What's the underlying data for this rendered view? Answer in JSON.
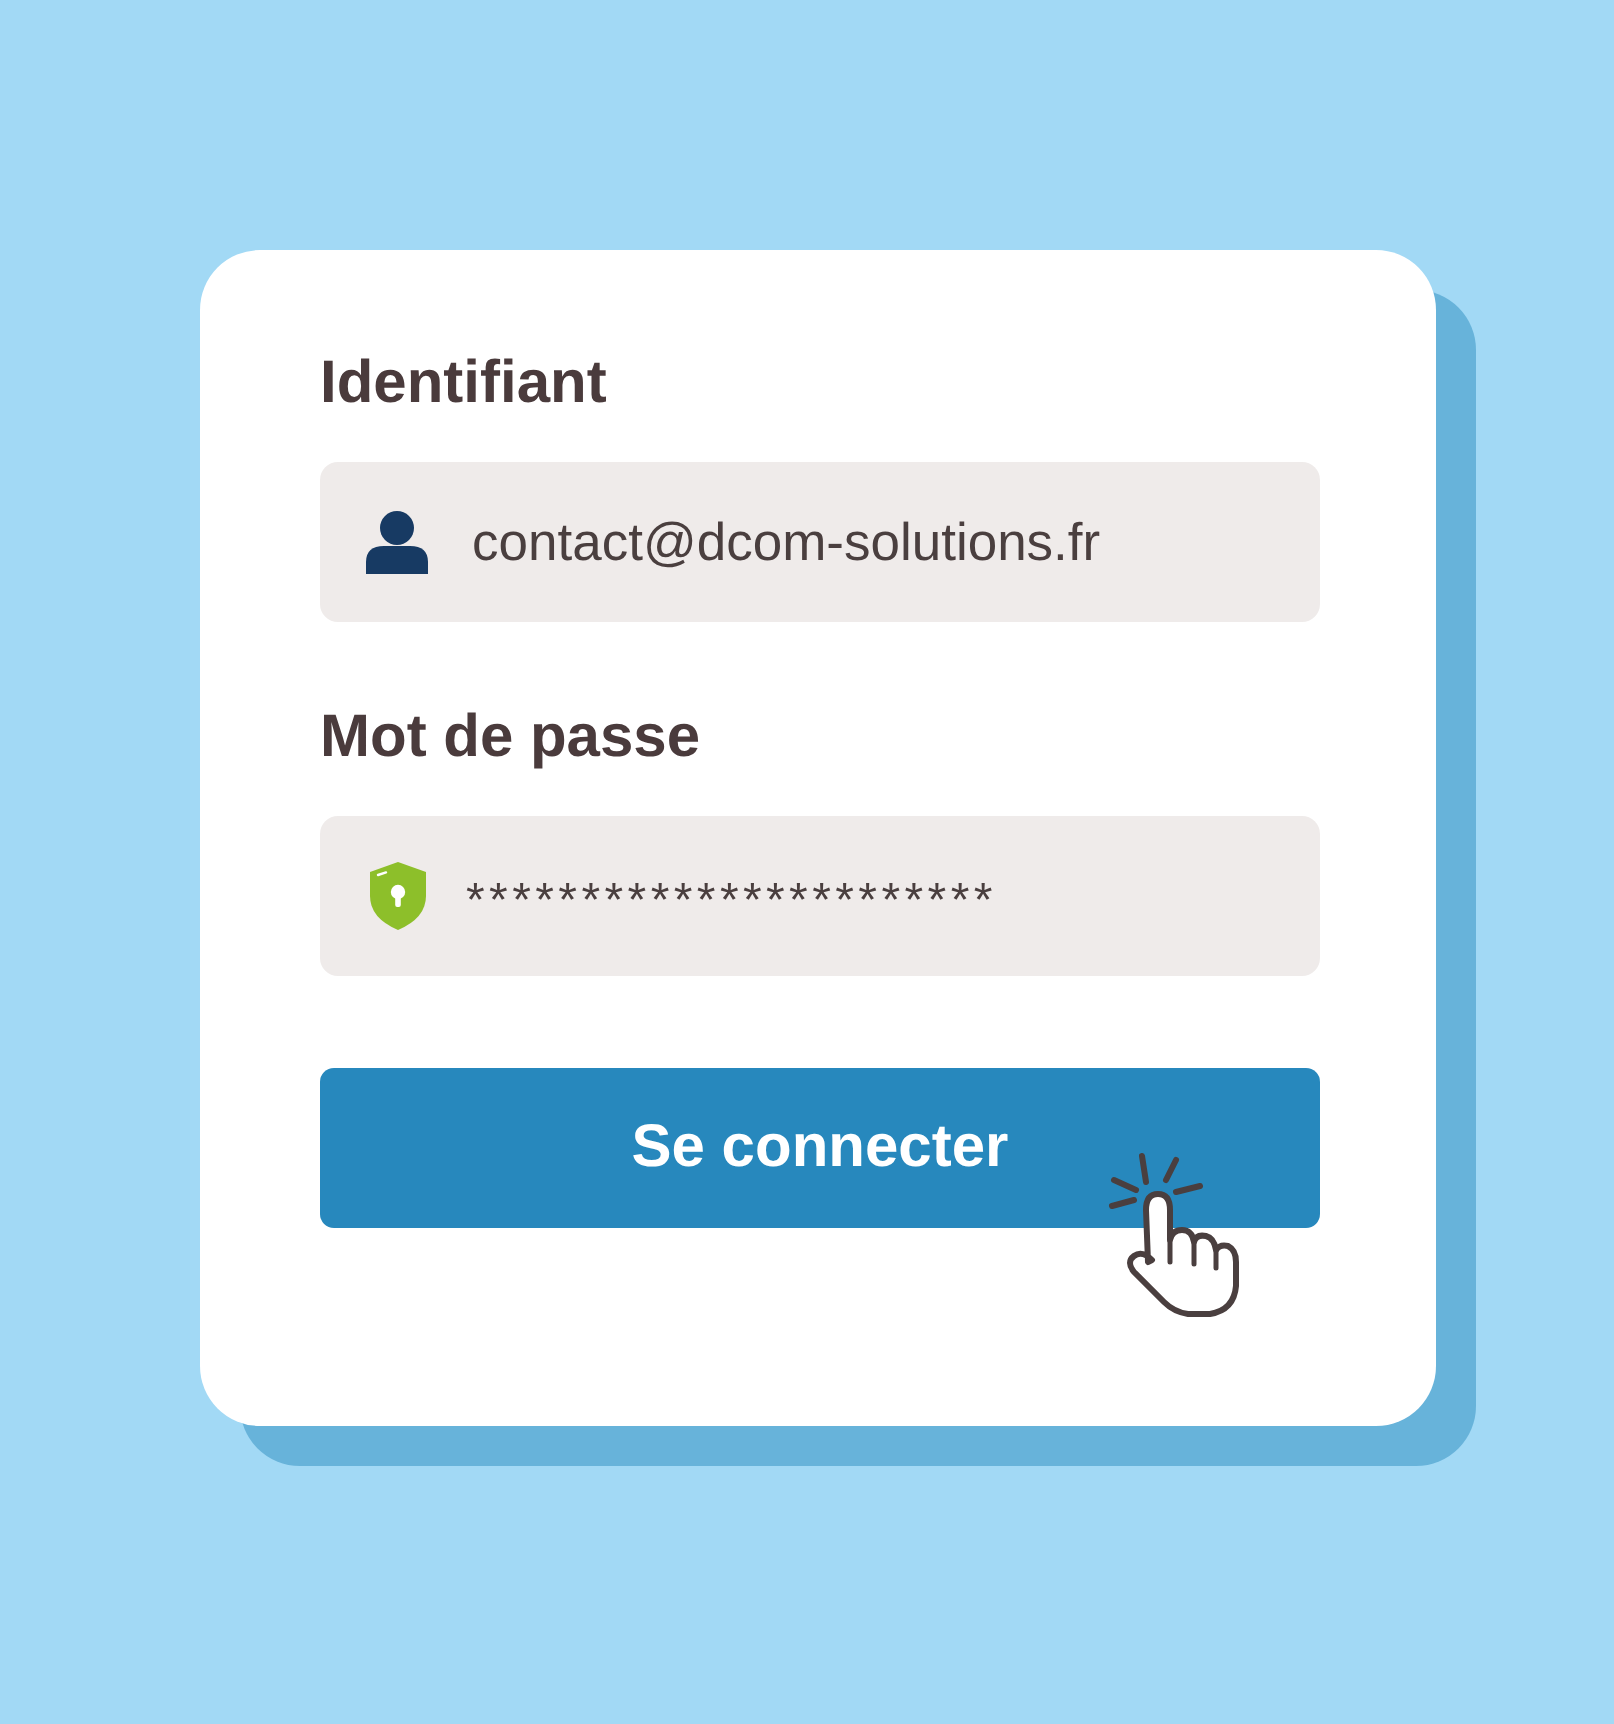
{
  "form": {
    "fields": [
      {
        "kind": "user",
        "label": "Identifiant",
        "value": "contact@dcom-solutions.fr"
      },
      {
        "kind": "password",
        "label": "Mot de passe",
        "value": "***********************"
      }
    ],
    "submit_button": {
      "label": "Se connecter"
    }
  }
}
